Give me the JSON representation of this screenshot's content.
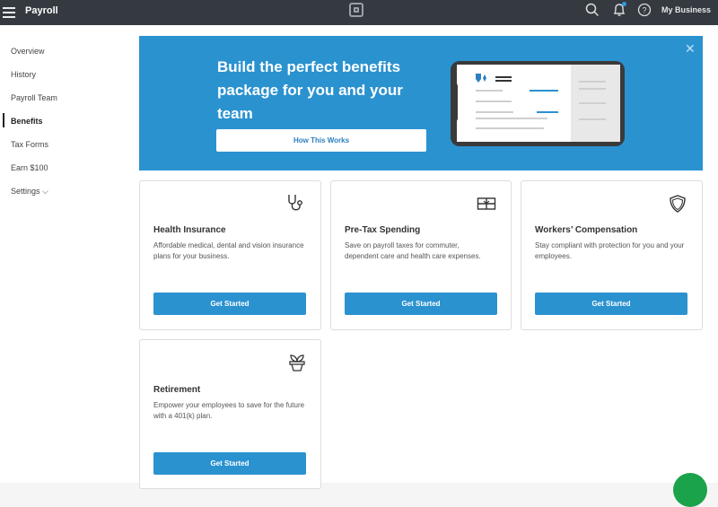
{
  "app": {
    "title": "Payroll",
    "business": "My Business"
  },
  "sidebar": {
    "items": [
      {
        "label": "Overview"
      },
      {
        "label": "History"
      },
      {
        "label": "Payroll Team"
      },
      {
        "label": "Benefits",
        "active": true
      },
      {
        "label": "Tax Forms"
      },
      {
        "label": "Earn $100"
      },
      {
        "label": "Settings ⌵"
      }
    ]
  },
  "hero": {
    "title": "Build the perfect benefits package for you and your team",
    "button": "How This Works"
  },
  "cards": [
    {
      "title": "Health Insurance",
      "text": "Affordable medical, dental and vision insurance plans for your business.",
      "button": "Get Started",
      "icon": "stethoscope-icon"
    },
    {
      "title": "Pre-Tax Spending",
      "text": "Save on payroll taxes for commuter, dependent care and health care expenses.",
      "button": "Get Started",
      "icon": "gift-card-icon"
    },
    {
      "title": "Workers’ Compensation",
      "text": "Stay compliant with protection for you and your employees.",
      "button": "Get Started",
      "icon": "shield-icon"
    },
    {
      "title": "Retirement",
      "text": "Empower your employees to save for the future with a 401(k) plan.",
      "button": "Get Started",
      "icon": "plant-pot-icon"
    }
  ],
  "colors": {
    "accent": "#2b92d0",
    "topbar": "#343a40",
    "chat": "#1aa34a"
  }
}
